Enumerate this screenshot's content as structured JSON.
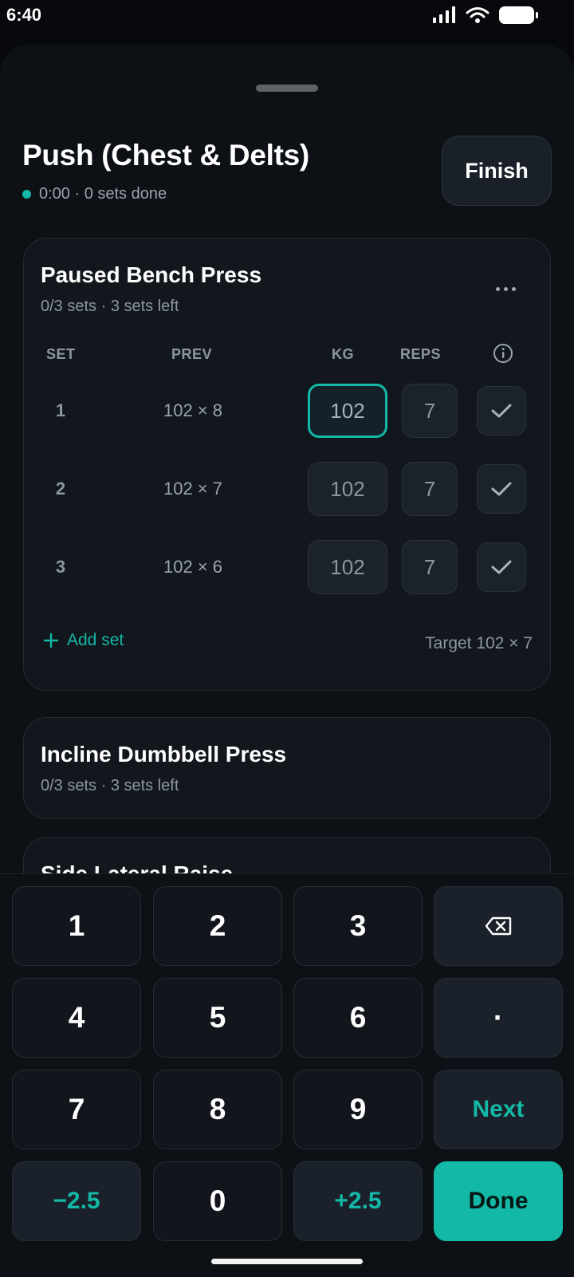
{
  "status_bar": {
    "time": "6:40"
  },
  "header": {
    "title": "Push (Chest & Delts)",
    "meta": "0:00 · 0 sets done",
    "finish_label": "Finish"
  },
  "exercise_1": {
    "title": "Paused Bench Press",
    "subtitle": "0/3 sets · 3 sets left",
    "columns": {
      "set": "SET",
      "prev": "PREV",
      "kg": "KG",
      "reps": "REPS"
    },
    "rows": [
      {
        "set": "1",
        "prev": "102 × 8",
        "kg": "102",
        "reps": "7"
      },
      {
        "set": "2",
        "prev": "102 × 7",
        "kg": "102",
        "reps": "7"
      },
      {
        "set": "3",
        "prev": "102 × 6",
        "kg": "102",
        "reps": "7"
      }
    ],
    "add_set": "Add set",
    "target": "Target 102 × 7"
  },
  "exercise_2": {
    "title": "Incline Dumbbell Press",
    "subtitle": "0/3 sets · 3 sets left"
  },
  "exercise_3": {
    "title": "Side Lateral Raise"
  },
  "keypad": {
    "k1": "1",
    "k2": "2",
    "k3": "3",
    "k4": "4",
    "k5": "5",
    "k6": "6",
    "k7": "7",
    "k8": "8",
    "k9": "9",
    "k0": "0",
    "decimal": "·",
    "next": "Next",
    "minus": "−2.5",
    "plus": "+2.5",
    "done": "Done"
  },
  "colors": {
    "accent": "#14b8a6",
    "background": "#07090d",
    "card": "#12171d"
  }
}
